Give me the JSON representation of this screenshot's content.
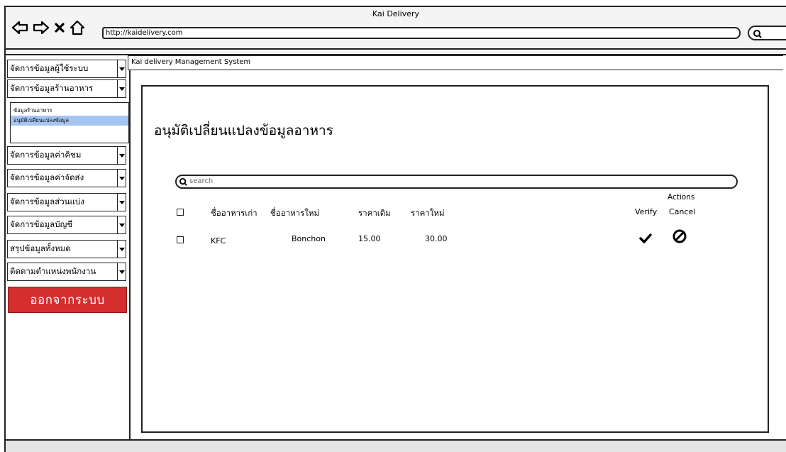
{
  "window": {
    "title": "Kai Delivery",
    "url": "http://kaidelivery.com"
  },
  "header": {
    "system_title": "Kai delivery Management System"
  },
  "sidebar": {
    "menus": [
      {
        "label": "จัดการข้อมูลผู้ใช้ระบบ"
      },
      {
        "label": "จัดการข้อมูลร้านอาหาร"
      },
      {
        "label": "จัดการข้อมูลค่าคิชม"
      },
      {
        "label": "จัดการข้อมูลค่าจัดส่ง"
      },
      {
        "label": "จัดการข้อมูลส่วนแบ่ง"
      },
      {
        "label": "จัดการข้อมูลบัญชี"
      },
      {
        "label": "สรุปข้อมูลทั้งหมด"
      },
      {
        "label": "ติดตามตำแหน่งพนักงาน"
      }
    ],
    "submenu": [
      {
        "label": "ข้อมูลร้านอาหาร"
      },
      {
        "label": "อนุมัติเปลี่ยนแปลงข้อมูล",
        "selected": true
      }
    ],
    "logout_label": "ออกจากระบบ"
  },
  "main": {
    "page_title": "อนุมัติเปลี่ยนแปลงข้อมูลอาหาร",
    "search_placeholder": "search",
    "table": {
      "columns": {
        "old_name": "ชื่ออาหารเก่า",
        "new_name": "ชื่ออาหารใหม่",
        "old_price": "ราคาเดิม",
        "new_price": "ราคาใหม่",
        "actions": "Actions",
        "verify": "Verify",
        "cancel": "Cancel"
      },
      "rows": [
        {
          "old_name": "KFC",
          "new_name": "Bonchon",
          "old_price": "15.00",
          "new_price": "30.00"
        }
      ]
    }
  },
  "icons": {
    "back": "arrow-left-icon",
    "forward": "arrow-right-icon",
    "stop": "close-icon",
    "home": "home-icon",
    "search": "search-icon",
    "verify": "check-icon",
    "cancel": "cancel-icon"
  },
  "colors": {
    "logout": "#d42e2e",
    "selected_submenu": "#a6c4f2"
  }
}
